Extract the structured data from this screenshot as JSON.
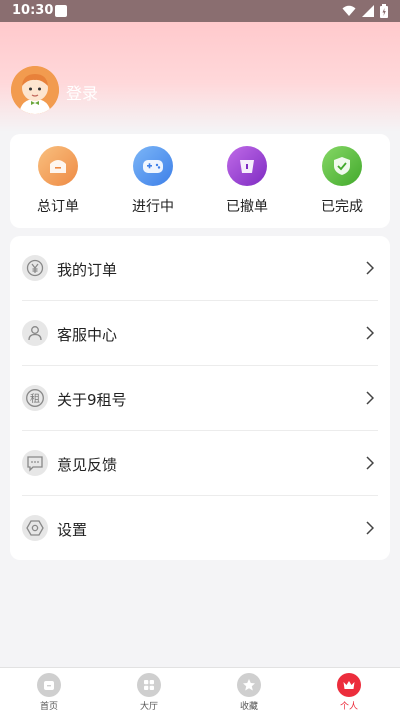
{
  "status_bar": {
    "time": "10:30"
  },
  "profile": {
    "login_label": "登录"
  },
  "quick_actions": [
    {
      "label": "总订单",
      "icon": "package-icon",
      "color": "#f5a25d"
    },
    {
      "label": "进行中",
      "icon": "gamepad-icon",
      "color": "#4a8ff0"
    },
    {
      "label": "已撤单",
      "icon": "cup-icon",
      "color": "#9b3fd6"
    },
    {
      "label": "已完成",
      "icon": "shield-check-icon",
      "color": "#5fbf3e"
    }
  ],
  "menu": [
    {
      "label": "我的订单",
      "icon": "yen-icon"
    },
    {
      "label": "客服中心",
      "icon": "person-icon"
    },
    {
      "label": "关于9租号",
      "icon": "rent-icon",
      "glyph": "租"
    },
    {
      "label": "意见反馈",
      "icon": "message-icon"
    },
    {
      "label": "设置",
      "icon": "settings-icon"
    }
  ],
  "tabbar": [
    {
      "label": "首页",
      "icon": "home-icon",
      "active": false
    },
    {
      "label": "大厅",
      "icon": "grid-icon",
      "active": false
    },
    {
      "label": "收藏",
      "icon": "star-icon",
      "active": false
    },
    {
      "label": "个人",
      "icon": "crown-icon",
      "active": true
    }
  ],
  "colors": {
    "accent": "#ec2d3c",
    "header_pink": "#ffc9cc"
  }
}
